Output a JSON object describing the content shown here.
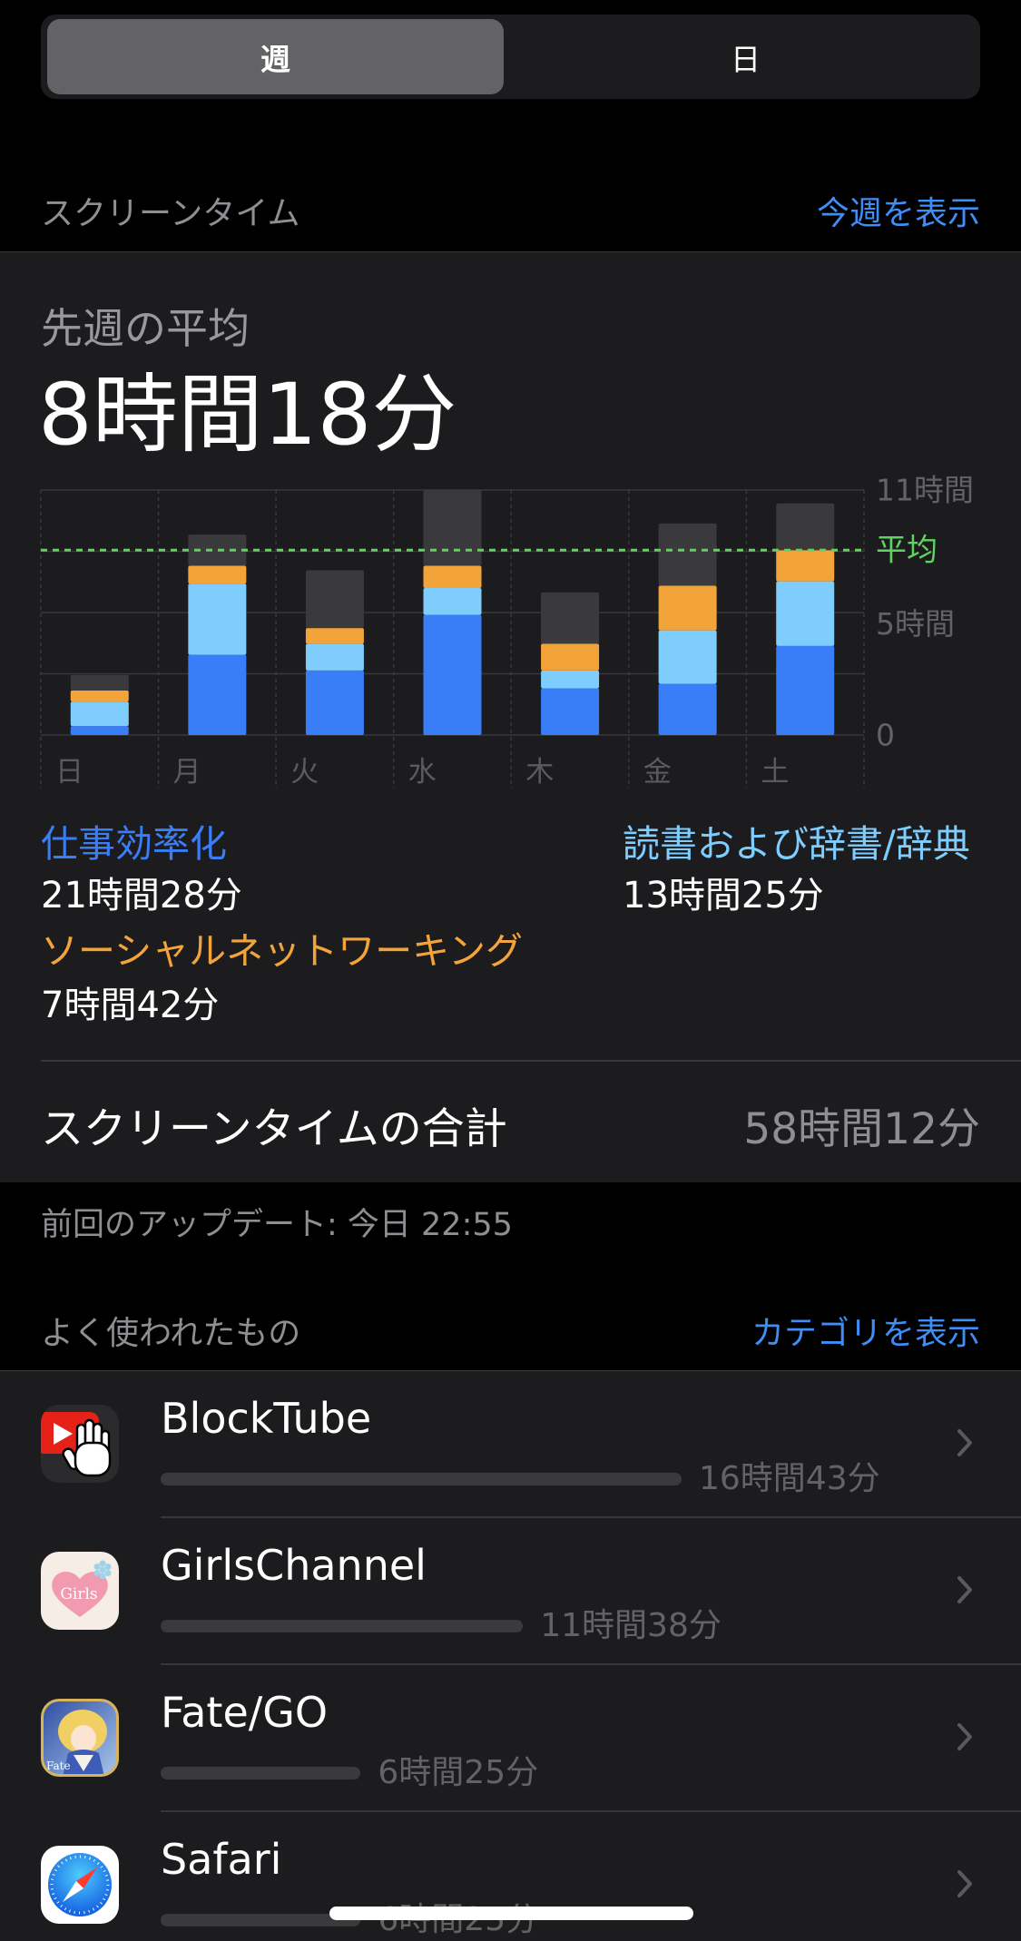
{
  "segmented": {
    "options": [
      "週",
      "日"
    ]
  },
  "screen_time": {
    "section_title": "スクリーンタイム",
    "show_link": "今週を表示"
  },
  "summary": {
    "label": "先週の平均",
    "value": "8時間18分"
  },
  "chart_data": {
    "type": "bar",
    "stacked": true,
    "categories": [
      "日",
      "月",
      "火",
      "水",
      "木",
      "金",
      "土"
    ],
    "series": [
      {
        "name": "仕事効率化",
        "total": "21時間28分",
        "color": "#3a7ef7",
        "values": [
          0.4,
          3.6,
          2.9,
          5.4,
          2.1,
          2.3,
          4.0
        ]
      },
      {
        "name": "読書および辞書/辞典",
        "total": "13時間25分",
        "color": "#7fcdfd",
        "values": [
          1.1,
          3.2,
          1.2,
          1.2,
          0.8,
          2.4,
          2.9
        ]
      },
      {
        "name": "ソーシャルネットワーキング",
        "total": "7時間42分",
        "color": "#f2a43a",
        "values": [
          0.5,
          0.8,
          0.7,
          1.0,
          1.2,
          2.0,
          1.4
        ]
      },
      {
        "color": "#3a3a3c",
        "values": [
          0.7,
          1.4,
          2.6,
          3.4,
          2.3,
          2.8,
          2.1
        ]
      }
    ],
    "ylim": [
      0,
      11
    ],
    "y_ticks": [
      {
        "value": 11,
        "label": "11時間"
      },
      {
        "value": 5,
        "label": "5時間"
      },
      {
        "value": 0,
        "label": "0"
      }
    ],
    "average": {
      "label": "平均",
      "value": 8.3,
      "color": "#5fd35f"
    },
    "grid": true,
    "legend": "below"
  },
  "total": {
    "label": "スクリーンタイムの合計",
    "value": "58時間12分"
  },
  "last_update": "前回のアップデート: 今日 22:55",
  "most_used": {
    "title": "よく使われたもの",
    "link": "カテゴリを表示",
    "apps": [
      {
        "name": "BlockTube",
        "time": "16時間43分",
        "usage_hours": 16.72,
        "icon": "blocktube-icon"
      },
      {
        "name": "GirlsChannel",
        "time": "11時間38分",
        "usage_hours": 11.63,
        "icon": "girlschannel-icon",
        "icon_logo_text": "Girls"
      },
      {
        "name": "Fate/GO",
        "time": "6時間25分",
        "usage_hours": 6.42,
        "icon": "fate-go-icon",
        "icon_logo_text": "Fate"
      },
      {
        "name": "Safari",
        "time": "6時間25分",
        "usage_hours": 6.42,
        "icon": "safari-icon"
      }
    ]
  },
  "colors": {
    "accent": "#3e8ef7",
    "background": "#000000",
    "card": "#1c1c1e",
    "secondary_text": "#8e8e93"
  }
}
